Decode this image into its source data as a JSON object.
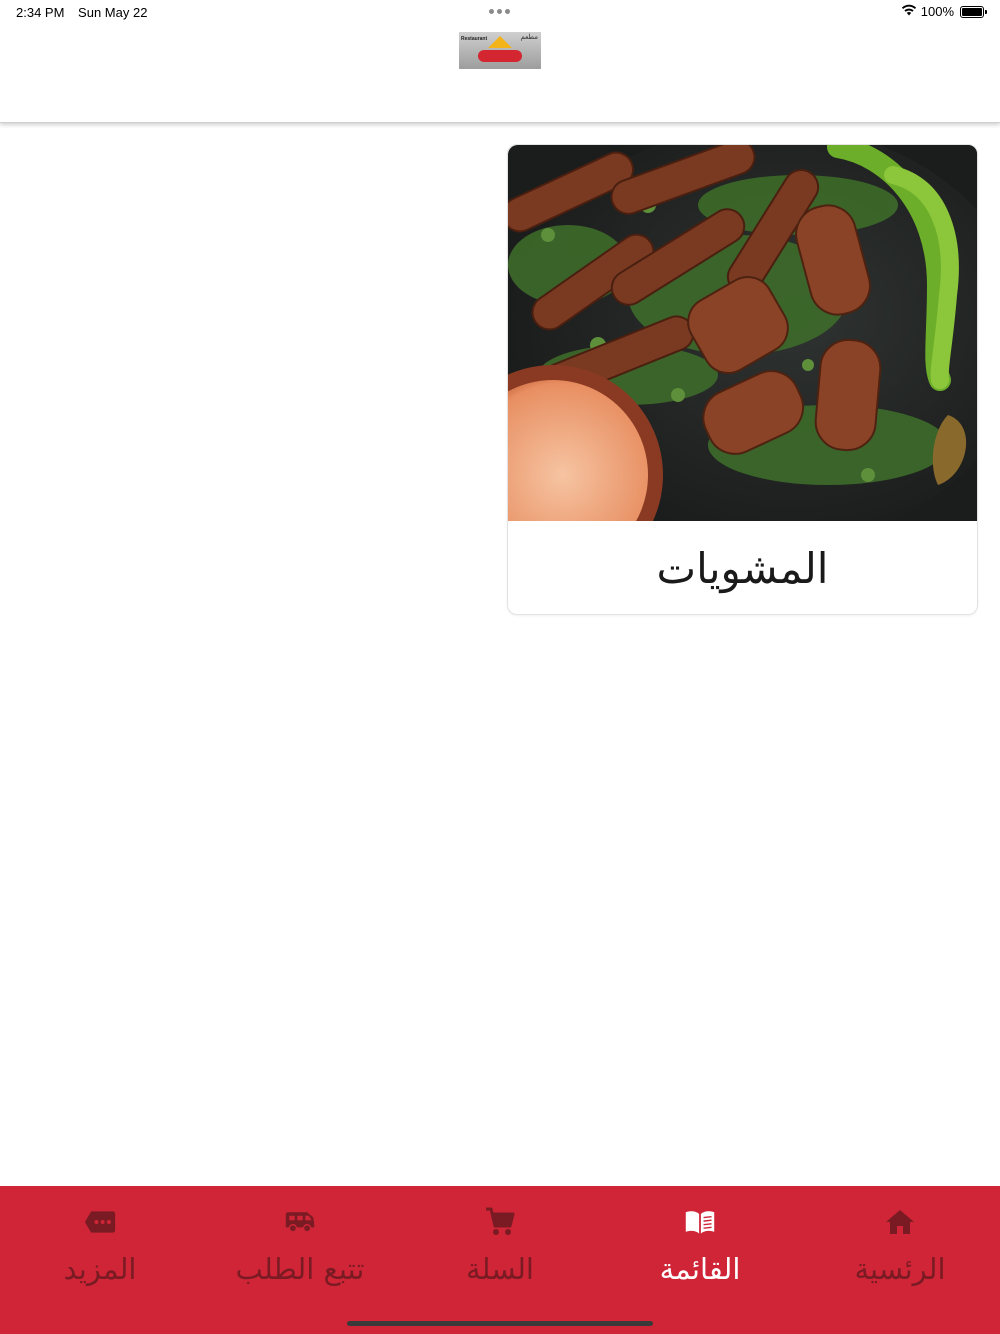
{
  "status_bar": {
    "time": "2:34 PM",
    "date": "Sun May 22",
    "battery": "100%"
  },
  "header": {
    "logo_text_en": "Restaurant",
    "logo_text_ar": "مطعم"
  },
  "categories": [
    {
      "title": "المشويات"
    }
  ],
  "tab_bar": {
    "tabs": [
      {
        "label": "الرئسية",
        "icon": "home-icon"
      },
      {
        "label": "القائمة",
        "icon": "menu-book-icon",
        "active": true
      },
      {
        "label": "السلة",
        "icon": "cart-icon"
      },
      {
        "label": "تتبع الطلب",
        "icon": "delivery-truck-icon"
      },
      {
        "label": "المزيد",
        "icon": "more-tag-icon"
      }
    ]
  },
  "colors": {
    "tab_bar_bg": "#cf2537",
    "tab_inactive": "#7a1b24",
    "tab_active": "#ffffff"
  }
}
